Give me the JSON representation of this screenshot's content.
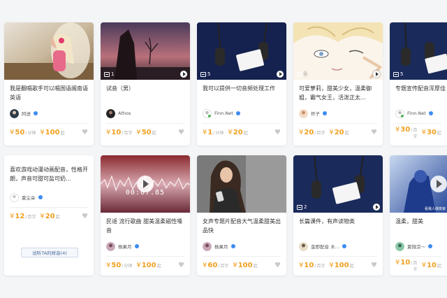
{
  "more_button": "试听TA的样音(4)",
  "colors": {
    "price": "#f0a020",
    "verified": "#3c8cf0",
    "heart": "#c8c8c8"
  },
  "cards": [
    {
      "title": "我是翻唱歌手可以唱国语闽南语英语",
      "author": "阿进",
      "badge": "",
      "price1": "50",
      "unit1": "分钟",
      "price2": "100",
      "unit2": "起",
      "cover": "girl-headphones"
    },
    {
      "title": "试音（男）",
      "author": "Athos",
      "badge": "1",
      "price1": "10",
      "unit1": "百字",
      "price2": "50",
      "unit2": "起",
      "cover": "sunset-tree"
    },
    {
      "title": "我可以提供一切音频处理工作",
      "author": "Finn.Net",
      "badge": "5",
      "price1": "1",
      "unit1": "分钟",
      "price2": "20",
      "unit2": "起",
      "cover": "studio-mic"
    },
    {
      "title": "可爱萝莉，甜美少女，温柔御姐，霸气女王，活泼正太...",
      "author": "怀子",
      "badge": "5",
      "price1": "20",
      "unit1": "百字",
      "price2": "20",
      "unit2": "起",
      "cover": "anime-boy"
    },
    {
      "title": "专题宣传配音浑厚佳",
      "author": "Finn.Net",
      "badge": "5",
      "price1": "30",
      "unit1": "百字",
      "price2": "30",
      "unit2": "起",
      "cover": "studio-mic"
    },
    {
      "title": "喜欢游戏动漫动画配音，性格开朗，声音可甜可盐可奶...",
      "author": "夏尘朵",
      "badge": "",
      "price1": "12",
      "unit1": "百字",
      "price2": "20",
      "unit2": "起",
      "cover": ""
    },
    {
      "title": "民谣 流行歌曲 甜美温柔磁性嗓音",
      "author": "杨果月",
      "badge": "",
      "price1": "50",
      "unit1": "分钟",
      "price2": "100",
      "unit2": "起",
      "cover": "waveform",
      "time": "00:07.85"
    },
    {
      "title": "女声专题片配音大气温柔甜美出品快",
      "author": "杨果月",
      "badge": "",
      "price1": "60",
      "unit1": "百字",
      "price2": "100",
      "unit2": "起",
      "cover": "girl-phone"
    },
    {
      "title": "长篇课件，有声读物类",
      "author": "金即配音 木...",
      "badge": "2",
      "price1": "10",
      "unit1": "百字",
      "price2": "100",
      "unit2": "起",
      "cover": "studio-mic"
    },
    {
      "title": "温柔，甜美",
      "author": "夏微凉～",
      "badge": "",
      "price1": "10",
      "unit1": "百字",
      "price2": "10",
      "unit2": "起",
      "cover": "blue-anime",
      "watermark": "看我人偶变装"
    }
  ]
}
